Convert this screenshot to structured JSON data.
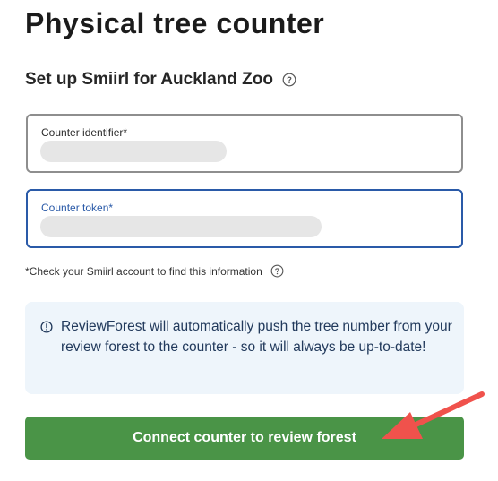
{
  "page": {
    "title": "Physical tree counter",
    "subtitle": "Set up Smiirl for Auckland Zoo"
  },
  "form": {
    "identifier": {
      "label": "Counter identifier*",
      "value": ""
    },
    "token": {
      "label": "Counter token*",
      "value": ""
    },
    "hint": "*Check your Smiirl account to find this information"
  },
  "info": {
    "text": "ReviewForest will automatically push the tree number from your review forest to the counter - so it will always be up-to-date!"
  },
  "actions": {
    "connect_label": "Connect counter to review forest"
  },
  "icons": {
    "subtitle_help": "question-circle-icon",
    "hint_help": "question-circle-icon",
    "info": "info-circle-icon",
    "annotation": "red-arrow-annotation"
  },
  "colors": {
    "button_green": "#4a9447",
    "focus_blue": "#2a5aa8",
    "info_bg": "#eef5fb",
    "arrow_red": "#f0524c"
  }
}
